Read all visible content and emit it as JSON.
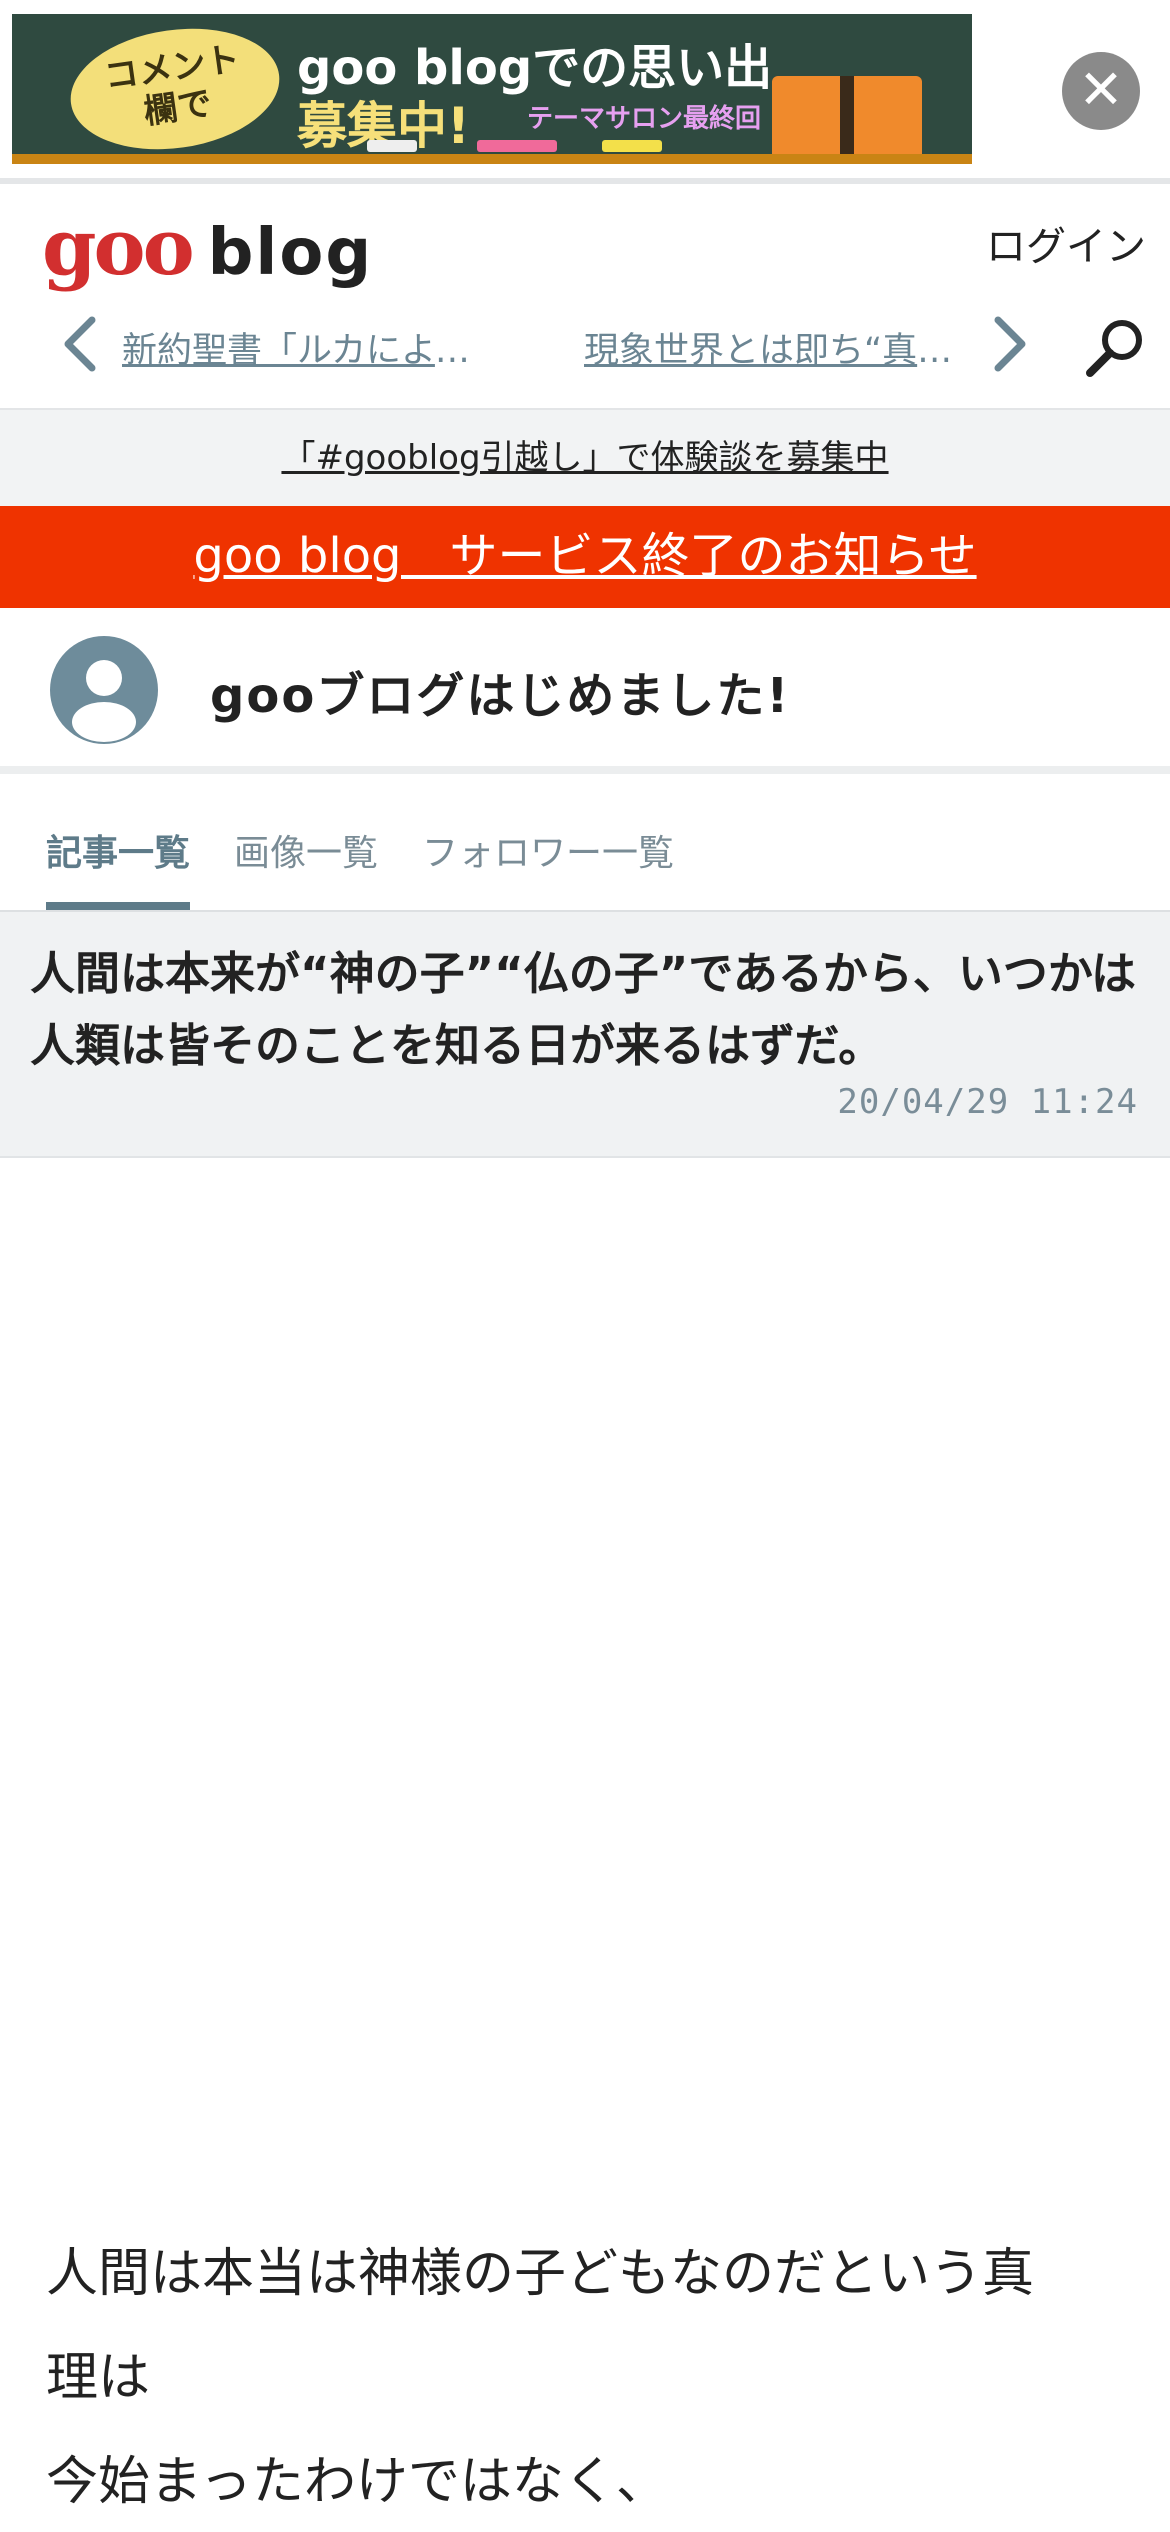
{
  "ad": {
    "bubble_text_1": "コメント",
    "bubble_text_2": "欄で",
    "headline_1": "goo blogでの思い出",
    "headline_2": "募集中!",
    "subline": "テーマサロン最終回",
    "close_symbol": "✕"
  },
  "header": {
    "logo_goo": "goo",
    "logo_blog": "blog",
    "login_label": "ログイン",
    "prev_article": "新約聖書「ルカによる福音書」",
    "next_article": "現象世界とは即ち“真理”"
  },
  "notices": {
    "campaign_link": "「#gooblog引越し」で体験談を募集中",
    "service_end_link": "goo blog　サービス終了のお知らせ"
  },
  "blog": {
    "title": "gooブログはじめました!"
  },
  "tabs": {
    "articles": "記事一覧",
    "images": "画像一覧",
    "followers": "フォロワー一覧"
  },
  "article": {
    "title": "人間は本来が“神の子”“仏の子”であるから、いつかは人類は皆そのことを知る日が来るはずだ。",
    "date": "20/04/29 11:24",
    "body_line_1": "人間は本当は神様の子どもなのだという真",
    "body_line_2": "理は",
    "body_line_3": "今始まったわけではなく、"
  },
  "colors": {
    "brand_red": "#d22f2f",
    "service_end_bg": "#ef3300",
    "accent_slate": "#5e7b89",
    "link_gray_blue": "#6b8593"
  },
  "icons": {
    "prev": "chevron-left-icon",
    "next": "chevron-right-icon",
    "search": "search-icon",
    "close": "close-icon",
    "avatar": "user-avatar-icon"
  }
}
